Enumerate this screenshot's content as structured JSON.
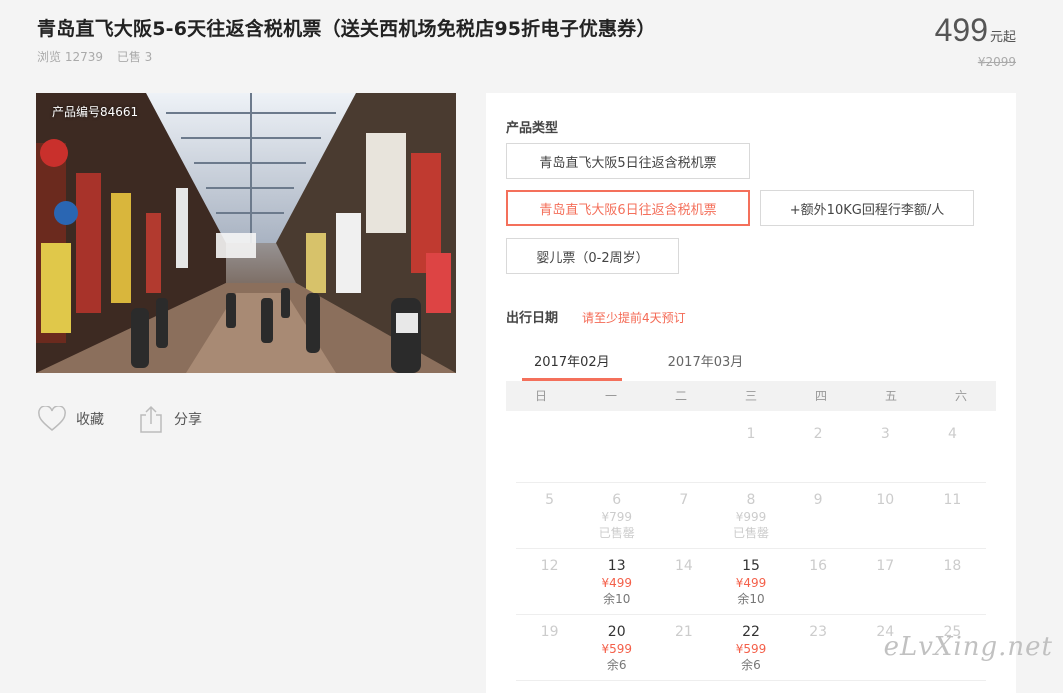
{
  "product": {
    "title": "青岛直飞大阪5-6天往返含税机票（送关西机场免税店95折电子优惠券）",
    "views": "浏览 12739",
    "sold": "已售 3",
    "price": "499",
    "price_unit": "元起",
    "original_price": "¥2099",
    "code": "产品编号84661"
  },
  "actions": {
    "favorite": "收藏",
    "share": "分享"
  },
  "booking": {
    "type_label": "产品类型",
    "options": [
      "青岛直飞大阪5日往返含税机票",
      "青岛直飞大阪6日往返含税机票",
      "+额外10KG回程行李额/人",
      "婴儿票（0-2周岁）"
    ],
    "date_label": "出行日期",
    "date_hint": "请至少提前4天预订",
    "months": [
      "2017年02月",
      "2017年03月"
    ],
    "weekdays": [
      "日",
      "一",
      "二",
      "三",
      "四",
      "五",
      "六"
    ],
    "calendar": [
      [
        {
          "d": ""
        },
        {
          "d": ""
        },
        {
          "d": ""
        },
        {
          "d": "1"
        },
        {
          "d": "2"
        },
        {
          "d": "3"
        },
        {
          "d": "4"
        }
      ],
      [
        {
          "d": "5"
        },
        {
          "d": "6",
          "p": "¥799",
          "s": "已售罄"
        },
        {
          "d": "7"
        },
        {
          "d": "8",
          "p": "¥999",
          "s": "已售罄"
        },
        {
          "d": "9"
        },
        {
          "d": "10"
        },
        {
          "d": "11"
        }
      ],
      [
        {
          "d": "12"
        },
        {
          "d": "13",
          "p": "¥499",
          "s": "余10",
          "a": true
        },
        {
          "d": "14"
        },
        {
          "d": "15",
          "p": "¥499",
          "s": "余10",
          "a": true
        },
        {
          "d": "16"
        },
        {
          "d": "17"
        },
        {
          "d": "18"
        }
      ],
      [
        {
          "d": "19"
        },
        {
          "d": "20",
          "p": "¥599",
          "s": "余6",
          "a": true
        },
        {
          "d": "21"
        },
        {
          "d": "22",
          "p": "¥599",
          "s": "余6",
          "a": true
        },
        {
          "d": "23"
        },
        {
          "d": "24"
        },
        {
          "d": "25"
        }
      ]
    ]
  },
  "watermark": "eLvXing.net",
  "colors": {
    "accent": "#f4705b",
    "price_red": "#f4604a"
  }
}
